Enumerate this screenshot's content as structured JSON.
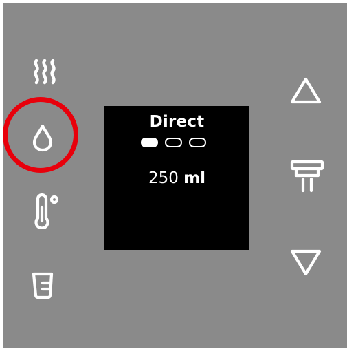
{
  "panel": {
    "background_color": "#8a8a8a",
    "highlight_color": "#e8000b",
    "left_buttons": [
      {
        "name": "steam",
        "icon": "steam-icon"
      },
      {
        "name": "water",
        "icon": "water-drop-icon",
        "highlighted": true
      },
      {
        "name": "temperature",
        "icon": "thermometer-icon"
      },
      {
        "name": "cup",
        "icon": "cup-icon"
      }
    ],
    "right_buttons": [
      {
        "name": "up",
        "icon": "triangle-up-icon"
      },
      {
        "name": "dispenser",
        "icon": "dispenser-icon"
      },
      {
        "name": "down",
        "icon": "triangle-down-icon"
      }
    ]
  },
  "display": {
    "mode": "Direct",
    "pages_total": 3,
    "active_page": 1,
    "volume_value": "250",
    "volume_unit": "ml"
  }
}
